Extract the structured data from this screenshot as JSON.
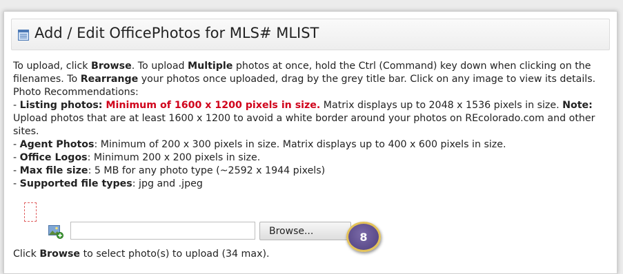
{
  "header": {
    "title": "Add / Edit OfficePhotos for MLS# MLIST",
    "icon": "list-document-icon"
  },
  "instructions": {
    "p1_t1": "To upload, click ",
    "p1_b1": "Browse",
    "p1_t2": ". To upload ",
    "p1_b2": "Multiple",
    "p1_t3": " photos at once, hold the Ctrl (Command) key down when clicking on the filenames. To ",
    "p1_b3": "Rearrange",
    "p1_t4": " your photos once uploaded, drag by the grey title bar. Click on any image to view its details.",
    "rec_heading": "Photo Recommendations:",
    "dash": "- ",
    "listing_label": "Listing photos: ",
    "listing_red": "Minimum of 1600 x 1200 pixels in size.",
    "listing_t1": " Matrix displays up to 2048 x 1536 pixels in size. ",
    "note_label": "Note:",
    "note_text": " Upload photos that are at least 1600 x 1200 to avoid a white border around your photos on REcolorado.com and other sites.",
    "agent_label": "Agent Photos",
    "agent_text": ": Minimum of 200 x 300 pixels in size. Matrix displays up to 400 x 600 pixels in size.",
    "office_label": "Office Logos",
    "office_text": ": Minimum 200 x 200 pixels in size.",
    "max_label": "Max file size",
    "max_text": ": 5 MB for any photo type (~2592 x 1944 pixels)",
    "types_label": "Supported file types",
    "types_text": ": jpg and .jpeg"
  },
  "upload": {
    "file_value": "",
    "browse_label": "Browse...",
    "hint_t1": "Click ",
    "hint_b": "Browse",
    "hint_t2": " to select photo(s) to upload (34 max)."
  },
  "step_badge": "8",
  "colors": {
    "required_red": "#d0021b",
    "badge_purple": "#5b4b8a",
    "badge_border": "#e3c25a"
  }
}
